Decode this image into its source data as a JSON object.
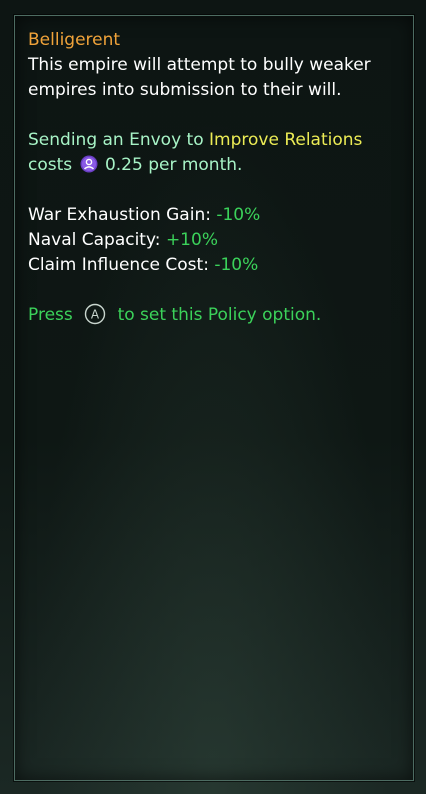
{
  "tooltip": {
    "title": "Belligerent",
    "description": "This empire will attempt to bully weaker empires into submission to their will.",
    "envoy": {
      "prefix": "Sending an Envoy to ",
      "highlight": "Improve Relations",
      "costs_word": "costs",
      "cost_icon": "influence-icon",
      "cost_text": " 0.25 per month."
    },
    "modifiers": [
      {
        "label": "War Exhaustion Gain: ",
        "value": "-10%"
      },
      {
        "label": "Naval Capacity: ",
        "value": "+10%"
      },
      {
        "label": "Claim Influence Cost: ",
        "value": "-10%"
      }
    ],
    "prompt": {
      "press": "Press",
      "button_icon": "a-button-icon",
      "button_letter": "A",
      "rest": "to set this Policy option."
    }
  },
  "colors": {
    "title": "#f0a33a",
    "teal": "#a7f3c6",
    "highlight": "#ecec55",
    "positive": "#3bd25a",
    "border": "#4d6c62"
  }
}
